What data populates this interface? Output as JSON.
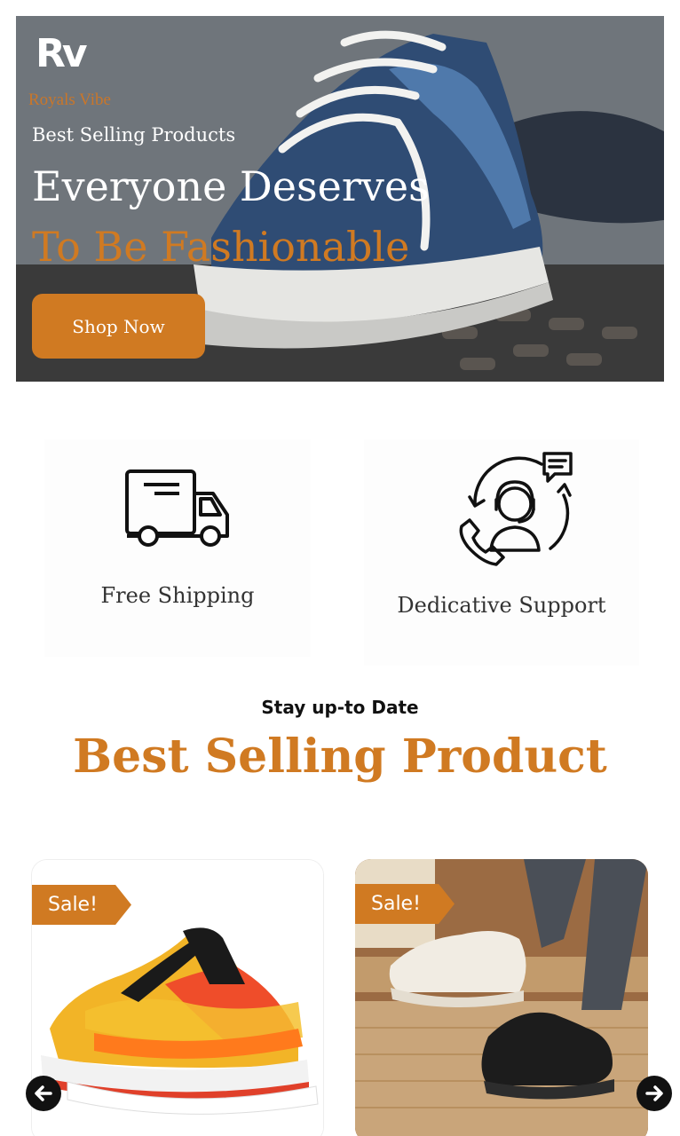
{
  "brand": {
    "mark": "Rv",
    "name": "Royals Vibe"
  },
  "hero": {
    "kicker": "Best Selling Products",
    "title_line1": "Everyone Deserves",
    "title_line2": "To Be Fashionable",
    "cta": "Shop Now"
  },
  "features": [
    {
      "label": "Free Shipping",
      "icon": "truck-icon"
    },
    {
      "label": "Dedicative Support",
      "icon": "support-agent-icon"
    }
  ],
  "section": {
    "kicker": "Stay up-to Date",
    "title": "Best Selling Product"
  },
  "products": [
    {
      "badge": "Sale!",
      "image": "yellow-running-shoes"
    },
    {
      "badge": "Sale!",
      "image": "white-and-black-sneakers"
    }
  ],
  "carousel": {
    "prev_icon": "arrow-left-icon",
    "next_icon": "arrow-right-icon"
  },
  "colors": {
    "accent": "#d07a22",
    "text": "#333333",
    "dark": "#111111"
  }
}
